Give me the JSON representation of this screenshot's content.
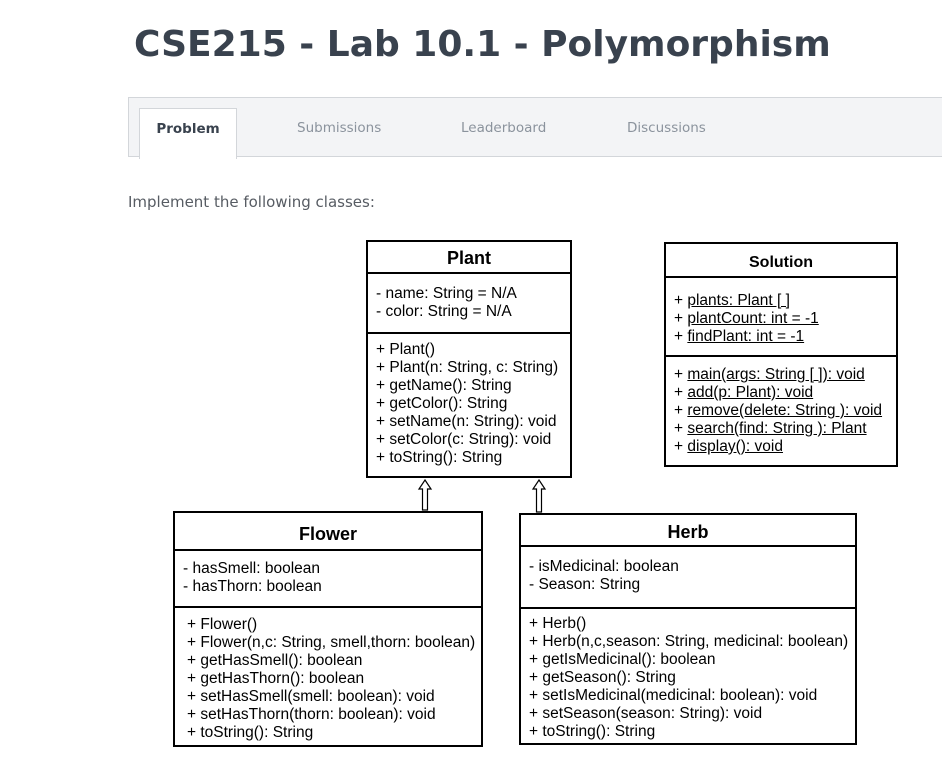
{
  "page": {
    "title": "CSE215 - Lab 10.1 - Polymorphism"
  },
  "tabs": [
    {
      "label": "Problem"
    },
    {
      "label": "Submissions"
    },
    {
      "label": "Leaderboard"
    },
    {
      "label": "Discussions"
    }
  ],
  "intro": "Implement the following classes:",
  "diagram": {
    "plant": {
      "name": "Plant",
      "attributes": [
        "- name: String = N/A",
        "- color: String = N/A"
      ],
      "methods": [
        "+ Plant()",
        "+ Plant(n: String, c: String)",
        "+ getName(): String",
        "+ getColor(): String",
        "+ setName(n: String): void",
        "+ setColor(c: String): void",
        "+ toString(): String"
      ]
    },
    "solution": {
      "name": "Solution",
      "attr_prefix": "+ ",
      "attributes": [
        "plants: Plant [ ]",
        "plantCount: int = -1",
        "findPlant: int = -1"
      ],
      "methods": [
        "main(args: String [ ]): void",
        "add(p: Plant): void",
        "remove(delete: String ): void",
        "search(find: String ): Plant",
        "display(): void"
      ]
    },
    "flower": {
      "name": "Flower",
      "attributes": [
        "- hasSmell: boolean",
        "- hasThorn: boolean"
      ],
      "methods": [
        "+ Flower()",
        "+ Flower(n,c: String, smell,thorn: boolean)",
        "+ getHasSmell(): boolean",
        "+ getHasThorn(): boolean",
        "+ setHasSmell(smell: boolean): void",
        "+ setHasThorn(thorn: boolean): void",
        "+ toString(): String"
      ]
    },
    "herb": {
      "name": "Herb",
      "attributes": [
        "- isMedicinal: boolean",
        "- Season: String"
      ],
      "methods": [
        "+ Herb()",
        "+ Herb(n,c,season: String, medicinal: boolean)",
        "+ getIsMedicinal(): boolean",
        "+ getSeason(): String",
        "+ setIsMedicinal(medicinal: boolean): void",
        "+ setSeason(season: String): void",
        "+ toString(): String"
      ]
    }
  }
}
